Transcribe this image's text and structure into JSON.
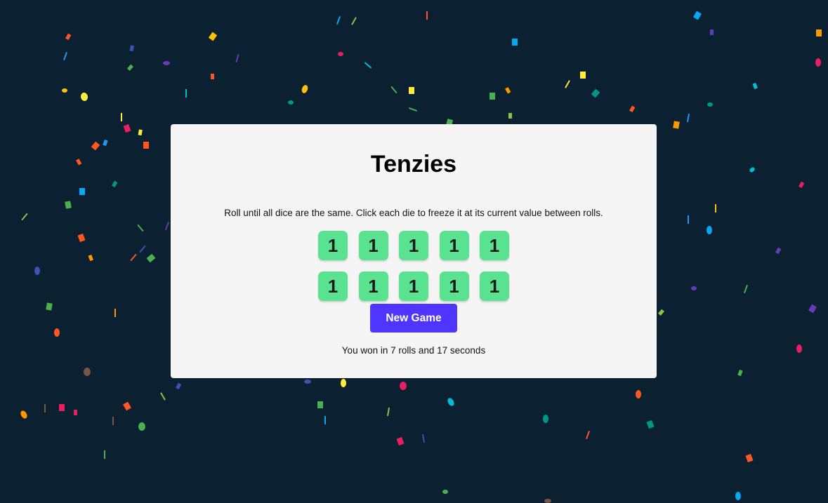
{
  "colors": {
    "background": "#0b2030",
    "card": "#f5f5f5",
    "die_held": "#59e391",
    "button": "#5035ff",
    "confetti": [
      "#e91e63",
      "#ff5722",
      "#ffc107",
      "#ffeb3b",
      "#8bc34a",
      "#4caf50",
      "#009688",
      "#00bcd4",
      "#03a9f4",
      "#2196f3",
      "#3f51b5",
      "#673ab7",
      "#9c27b0",
      "#795548",
      "#ff9800",
      "#cddc39"
    ]
  },
  "game": {
    "title": "Tenzies",
    "instructions": "Roll until all dice are the same. Click each die to freeze it at its current value between rolls.",
    "dice": [
      {
        "value": "1",
        "held": true
      },
      {
        "value": "1",
        "held": true
      },
      {
        "value": "1",
        "held": true
      },
      {
        "value": "1",
        "held": true
      },
      {
        "value": "1",
        "held": true
      },
      {
        "value": "1",
        "held": true
      },
      {
        "value": "1",
        "held": true
      },
      {
        "value": "1",
        "held": true
      },
      {
        "value": "1",
        "held": true
      },
      {
        "value": "1",
        "held": true
      }
    ],
    "button_label": "New Game",
    "win_message": "You won in 7 rolls and 17 seconds"
  }
}
